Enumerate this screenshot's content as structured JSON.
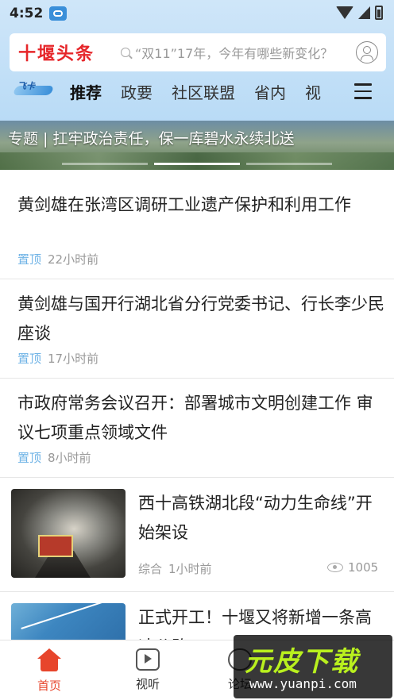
{
  "status_bar": {
    "time": "4:52"
  },
  "header": {
    "logo": "十堰头条",
    "search_placeholder": "“双11”17年，今年有哪些新变化？",
    "feika_label": "飞卡"
  },
  "tabs": [
    {
      "label": "推荐",
      "active": true
    },
    {
      "label": "政要"
    },
    {
      "label": "社区联盟"
    },
    {
      "label": "省内"
    },
    {
      "label": "视"
    }
  ],
  "banner": {
    "caption": "专题 | 扛牢政治责任，保一库碧水永续北送",
    "slide_index": 2,
    "slide_count": 3
  },
  "news": [
    {
      "title": "黄剑雄在张湾区调研工业遗产保护和利用工作",
      "tag": "置顶",
      "time": "22小时前"
    },
    {
      "title": "黄剑雄与国开行湖北省分行党委书记、行长李少民座谈",
      "tag": "置顶",
      "time": "17小时前"
    },
    {
      "title": "市政府常务会议召开：部署城市文明创建工作 审议七项重点领域文件",
      "tag": "置顶",
      "time": "8小时前"
    },
    {
      "title": "西十高铁湖北段“动力生命线”开始架设",
      "tag": "综合",
      "time": "1小时前",
      "views": "1005"
    },
    {
      "title": "正式开工！十堰又将新增一条高速公路"
    }
  ],
  "bottom_nav": [
    {
      "label": "首页",
      "active": true
    },
    {
      "label": "视听"
    },
    {
      "label": "论坛"
    }
  ],
  "watermark": {
    "text": "元皮下载",
    "url": "www.yuanpi.com"
  },
  "colors": {
    "accent": "#e6262a",
    "tag": "#6fb3e6",
    "header_bg": "#cfe6f9",
    "nav_active": "#e7452c"
  }
}
